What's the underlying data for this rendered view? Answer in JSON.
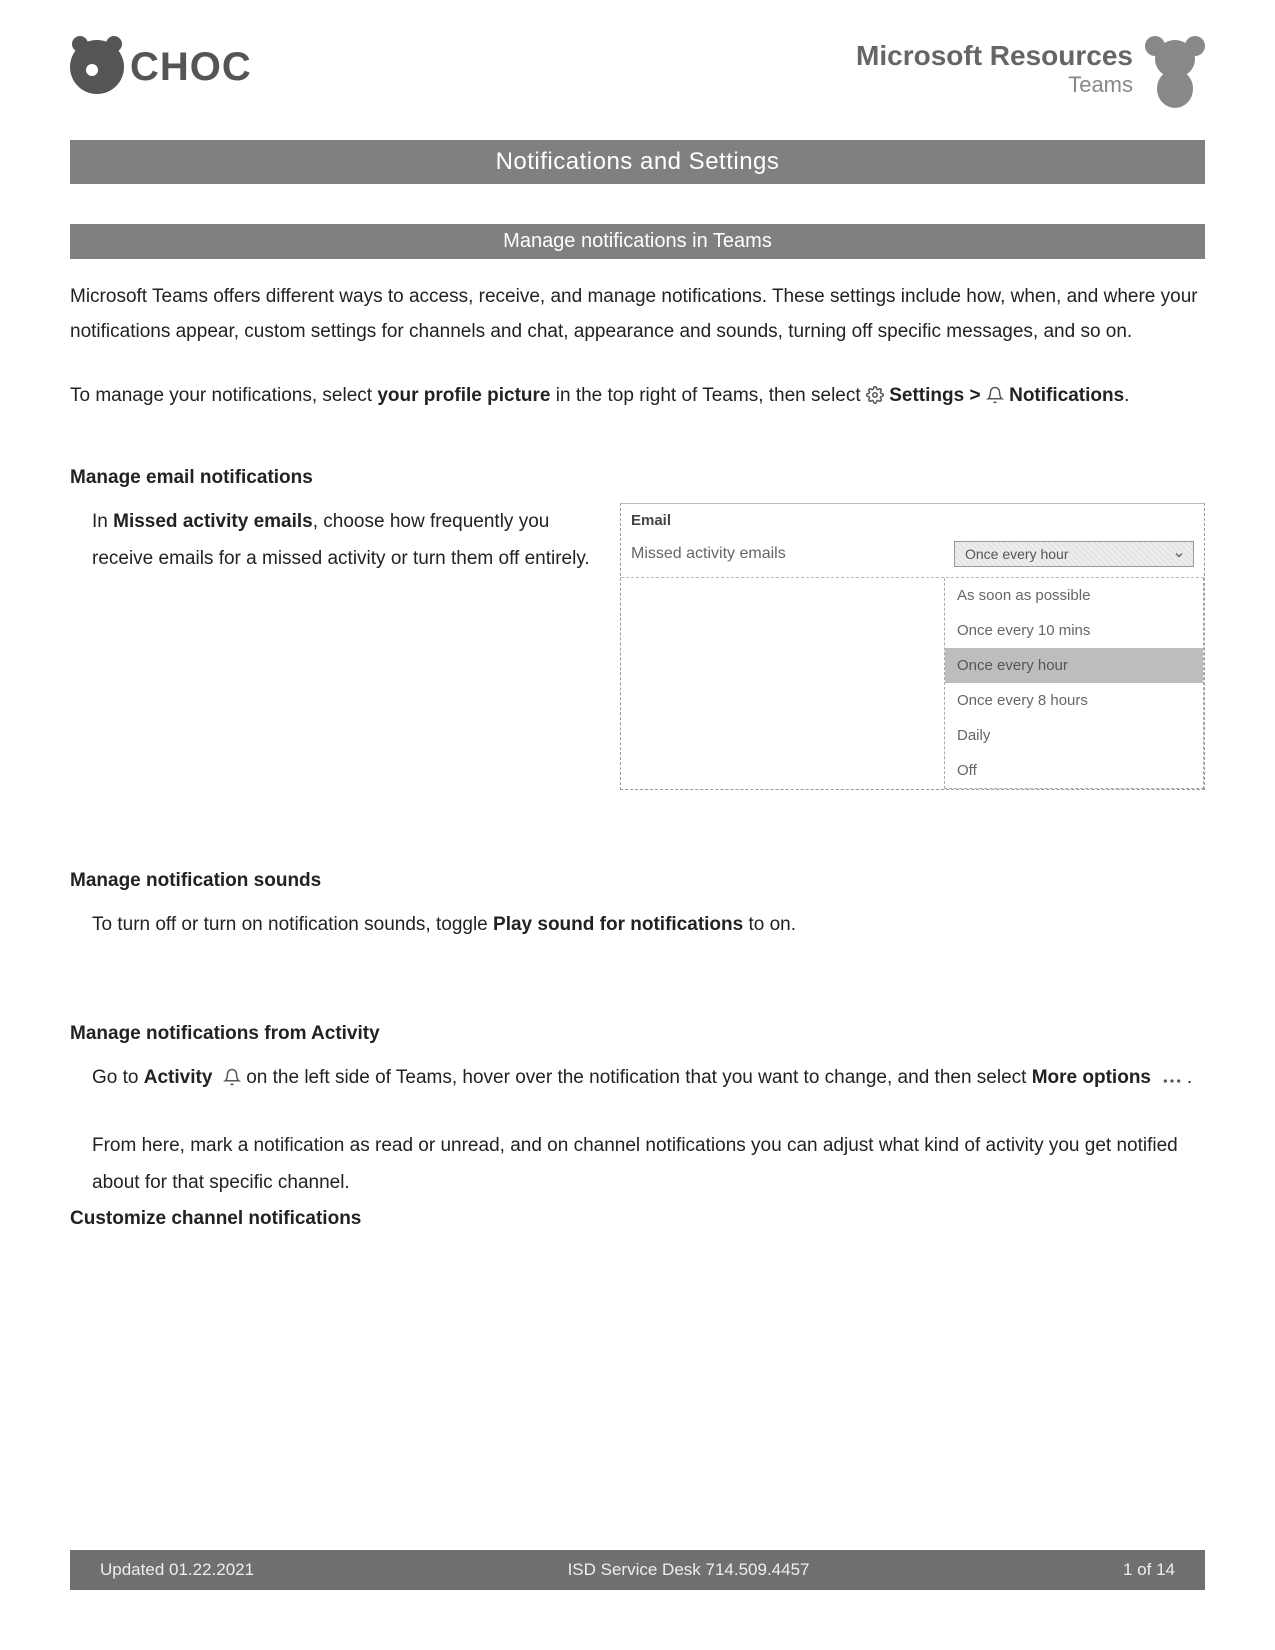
{
  "header": {
    "logo_text": "CHOC",
    "ms_title": "Microsoft Resources",
    "ms_sub": "Teams"
  },
  "banner_main": "Notifications and Settings",
  "banner_sub": "Manage notifications in Teams",
  "intro": "Microsoft Teams offers different ways to access, receive, and manage notifications. These settings include how, when, and where your notifications appear, custom settings for channels and chat, appearance and sounds, turning off specific messages, and so on.",
  "manage_line": {
    "pre": "To manage your notifications, select ",
    "bold1": "your profile picture",
    "mid": " in the top right of Teams, then select ",
    "settings": "Settings",
    "gt": " > ",
    "notifications": "Notifications",
    "end": "."
  },
  "sec_email": {
    "heading": "Manage email notifications",
    "body_pre": "In ",
    "body_bold": "Missed activity emails",
    "body_post": ", choose how frequently you receive emails for a missed activity or turn them off entirely."
  },
  "email_panel": {
    "title": "Email",
    "label": "Missed activity emails",
    "selected": "Once every hour",
    "options": [
      "As soon as possible",
      "Once every 10 mins",
      "Once every hour",
      "Once every 8 hours",
      "Daily",
      "Off"
    ],
    "selected_index": 2
  },
  "sec_sounds": {
    "heading": "Manage notification sounds",
    "body_pre": "To turn off or turn on notification sounds, toggle ",
    "body_bold": "Play sound for notifications",
    "body_post": " to on."
  },
  "sec_activity": {
    "heading": "Manage notifications from Activity",
    "l1_pre": "Go to ",
    "l1_b1": "Activity",
    "l1_mid": " on the left side of Teams, hover over the notification that you want to change, and then select ",
    "l1_b2": "More options",
    "l1_end": " .",
    "l2": "From here, mark a notification as read or unread, and on channel notifications you can adjust what kind of activity you get notified about for that specific channel."
  },
  "sec_custom": {
    "heading": "Customize channel notifications"
  },
  "footer": {
    "left": "Updated 01.22.2021",
    "center": "ISD Service Desk 714.509.4457",
    "right": "1 of 14"
  }
}
